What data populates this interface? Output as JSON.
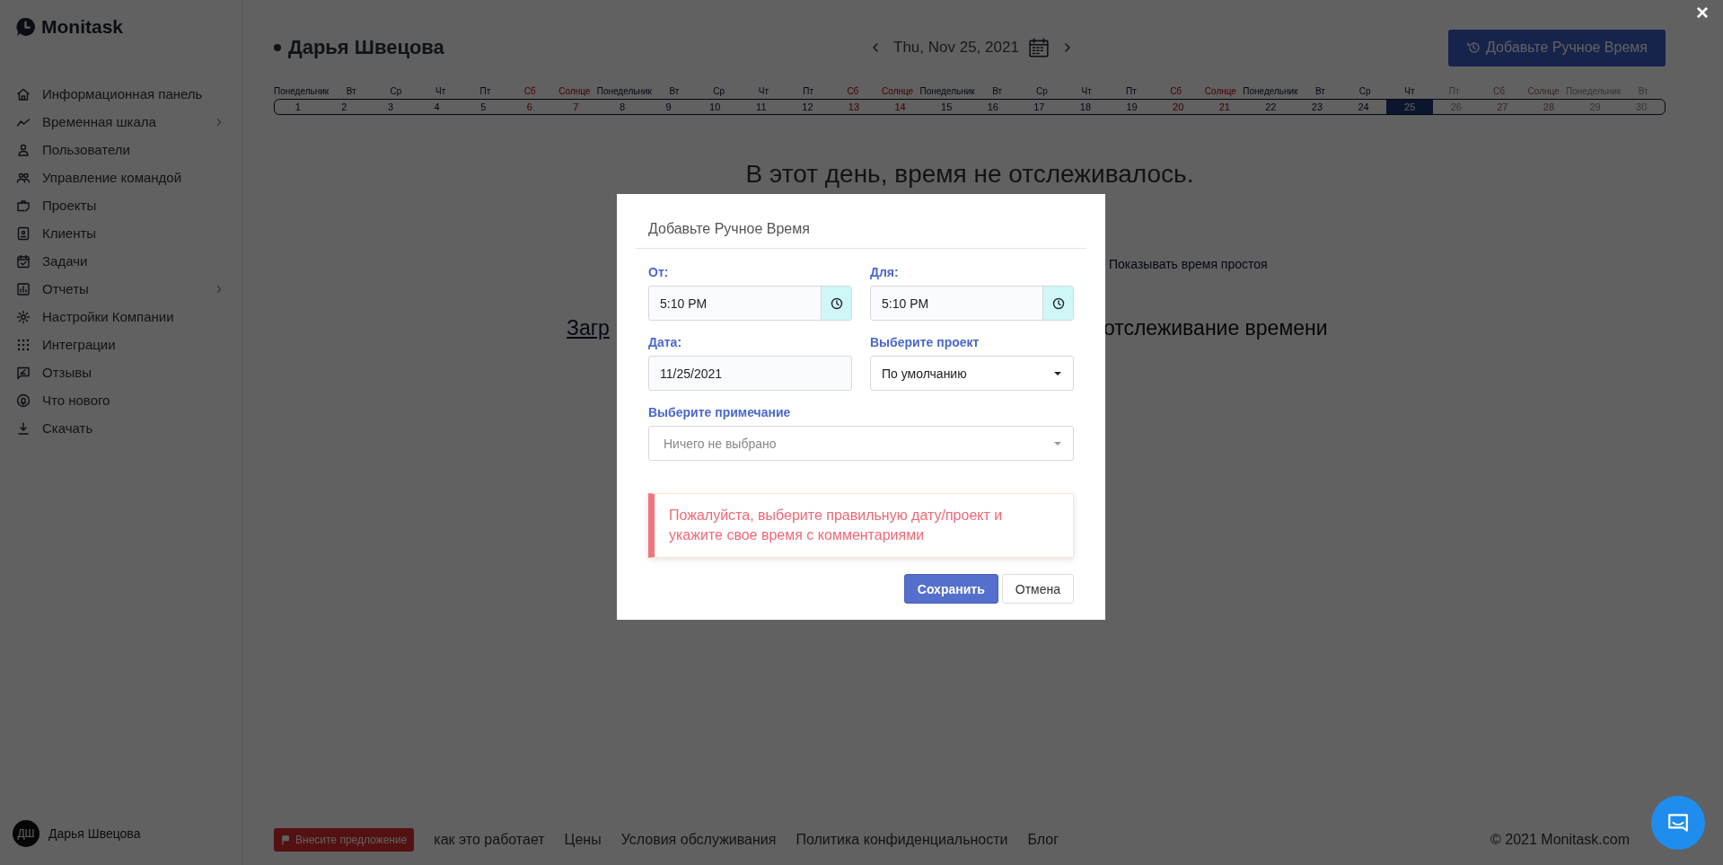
{
  "sidebar": {
    "logo": "Monitask",
    "items": [
      {
        "label": "Информационная панель",
        "expandable": false
      },
      {
        "label": "Временная шкала",
        "expandable": true
      },
      {
        "label": "Пользователи",
        "expandable": false
      },
      {
        "label": "Управление командой",
        "expandable": false
      },
      {
        "label": "Проекты",
        "expandable": false
      },
      {
        "label": "Клиенты",
        "expandable": false
      },
      {
        "label": "Задачи",
        "expandable": false
      },
      {
        "label": "Отчеты",
        "expandable": true
      },
      {
        "label": "Настройки Компании",
        "expandable": false
      },
      {
        "label": "Интеграции",
        "expandable": false
      },
      {
        "label": "Отзывы",
        "expandable": false
      },
      {
        "label": "Что нового",
        "expandable": false
      },
      {
        "label": "Скачать",
        "expandable": false
      }
    ],
    "user": {
      "initials": "ДШ",
      "name": "Дарья Швецова"
    }
  },
  "header": {
    "user_name": "Дарья Швецова",
    "date": "Thu, Nov 25, 2021",
    "add_button": "Добавьте Ручное Время"
  },
  "day_strip": [
    {
      "weekday": "Понедельник",
      "day": "1",
      "weekend": false,
      "selected": false,
      "disabled": false
    },
    {
      "weekday": "Вт",
      "day": "2",
      "weekend": false,
      "selected": false,
      "disabled": false
    },
    {
      "weekday": "Ср",
      "day": "3",
      "weekend": false,
      "selected": false,
      "disabled": false
    },
    {
      "weekday": "Чт",
      "day": "4",
      "weekend": false,
      "selected": false,
      "disabled": false
    },
    {
      "weekday": "Пт",
      "day": "5",
      "weekend": false,
      "selected": false,
      "disabled": false
    },
    {
      "weekday": "Сб",
      "day": "6",
      "weekend": true,
      "selected": false,
      "disabled": false
    },
    {
      "weekday": "Солнце",
      "day": "7",
      "weekend": true,
      "selected": false,
      "disabled": false
    },
    {
      "weekday": "Понедельник",
      "day": "8",
      "weekend": false,
      "selected": false,
      "disabled": false
    },
    {
      "weekday": "Вт",
      "day": "9",
      "weekend": false,
      "selected": false,
      "disabled": false
    },
    {
      "weekday": "Ср",
      "day": "10",
      "weekend": false,
      "selected": false,
      "disabled": false
    },
    {
      "weekday": "Чт",
      "day": "11",
      "weekend": false,
      "selected": false,
      "disabled": false
    },
    {
      "weekday": "Пт",
      "day": "12",
      "weekend": false,
      "selected": false,
      "disabled": false
    },
    {
      "weekday": "Сб",
      "day": "13",
      "weekend": true,
      "selected": false,
      "disabled": false
    },
    {
      "weekday": "Солнце",
      "day": "14",
      "weekend": true,
      "selected": false,
      "disabled": false
    },
    {
      "weekday": "Понедельник",
      "day": "15",
      "weekend": false,
      "selected": false,
      "disabled": false
    },
    {
      "weekday": "Вт",
      "day": "16",
      "weekend": false,
      "selected": false,
      "disabled": false
    },
    {
      "weekday": "Ср",
      "day": "17",
      "weekend": false,
      "selected": false,
      "disabled": false
    },
    {
      "weekday": "Чт",
      "day": "18",
      "weekend": false,
      "selected": false,
      "disabled": false
    },
    {
      "weekday": "Пт",
      "day": "19",
      "weekend": false,
      "selected": false,
      "disabled": false
    },
    {
      "weekday": "Сб",
      "day": "20",
      "weekend": true,
      "selected": false,
      "disabled": false
    },
    {
      "weekday": "Солнце",
      "day": "21",
      "weekend": true,
      "selected": false,
      "disabled": false
    },
    {
      "weekday": "Понедельник",
      "day": "22",
      "weekend": false,
      "selected": false,
      "disabled": false
    },
    {
      "weekday": "Вт",
      "day": "23",
      "weekend": false,
      "selected": false,
      "disabled": false
    },
    {
      "weekday": "Ср",
      "day": "24",
      "weekend": false,
      "selected": false,
      "disabled": false
    },
    {
      "weekday": "Чт",
      "day": "25",
      "weekend": false,
      "selected": true,
      "disabled": false
    },
    {
      "weekday": "Пт",
      "day": "26",
      "weekend": false,
      "selected": false,
      "disabled": true
    },
    {
      "weekday": "Сб",
      "day": "27",
      "weekend": true,
      "selected": false,
      "disabled": true
    },
    {
      "weekday": "Солнце",
      "day": "28",
      "weekend": true,
      "selected": false,
      "disabled": true
    },
    {
      "weekday": "Понедельник",
      "day": "29",
      "weekend": false,
      "selected": false,
      "disabled": true
    },
    {
      "weekday": "Вт",
      "day": "30",
      "weekend": false,
      "selected": false,
      "disabled": true
    }
  ],
  "empty_state": {
    "message": "В этот день, время не отслеживалось.",
    "idle_toggle": "Показывать время простоя",
    "link_fragment": "Загр",
    "text_fragment": "отслеживание времени"
  },
  "modal": {
    "title": "Добавьте Ручное Время",
    "fields": [
      {
        "kind": "time",
        "label": "От:",
        "value": "5:10 PM"
      },
      {
        "kind": "time",
        "label": "Для:",
        "value": "5:10 PM"
      },
      {
        "kind": "date",
        "label": "Дата:",
        "value": "11/25/2021"
      },
      {
        "kind": "select",
        "label": "Выберите проект",
        "value": "По умолчанию"
      },
      {
        "kind": "multiselect",
        "label": "Выберите примечание",
        "placeholder": "Ничего не выбрано"
      }
    ],
    "alert": "Пожалуйста, выберите правильную дату/проект и укажите свое время с комментариями",
    "buttons": [
      {
        "label": "Сохранить",
        "primary": true
      },
      {
        "label": "Отмена",
        "primary": false
      }
    ]
  },
  "footer": {
    "suggest_button": "Внесите предложение",
    "links": [
      "как это работает",
      "Цены",
      "Условия обслуживания",
      "Политика конфиденциальности",
      "Блог"
    ],
    "copyright": "© 2021 Monitask.com"
  },
  "close_label": "×"
}
